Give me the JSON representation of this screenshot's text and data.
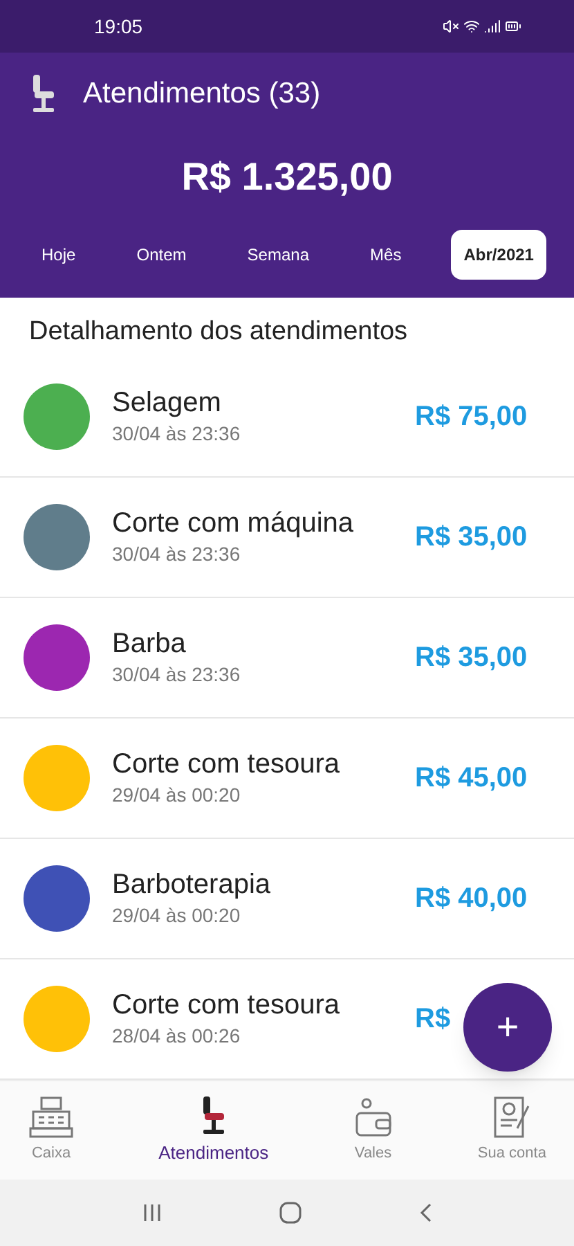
{
  "status_bar": {
    "time": "19:05"
  },
  "header": {
    "title": "Atendimentos (33)",
    "total": "R$ 1.325,00"
  },
  "tabs": [
    {
      "label": "Hoje",
      "selected": false
    },
    {
      "label": "Ontem",
      "selected": false
    },
    {
      "label": "Semana",
      "selected": false
    },
    {
      "label": "Mês",
      "selected": false
    },
    {
      "label": "Abr/2021",
      "selected": true
    }
  ],
  "list": {
    "title": "Detalhamento dos atendimentos",
    "items": [
      {
        "name": "Selagem",
        "date": "30/04 às 23:36",
        "price": "R$ 75,00",
        "color": "#4caf50"
      },
      {
        "name": "Corte com máquina",
        "date": "30/04 às 23:36",
        "price": "R$ 35,00",
        "color": "#607d8b"
      },
      {
        "name": "Barba",
        "date": "30/04 às 23:36",
        "price": "R$ 35,00",
        "color": "#9c27b0"
      },
      {
        "name": "Corte com tesoura",
        "date": "29/04 às 00:20",
        "price": "R$ 45,00",
        "color": "#ffc107"
      },
      {
        "name": "Barboterapia",
        "date": "29/04 às 00:20",
        "price": "R$ 40,00",
        "color": "#3f51b5"
      },
      {
        "name": "Corte com tesoura",
        "date": "28/04 às 00:26",
        "price": "R$",
        "color": "#ffc107"
      }
    ]
  },
  "fab": {
    "label": "+"
  },
  "bottom_nav": [
    {
      "label": "Caixa",
      "kind": "register",
      "selected": false
    },
    {
      "label": "Atendimentos",
      "kind": "chair",
      "selected": true
    },
    {
      "label": "Vales",
      "kind": "wallet",
      "selected": false
    },
    {
      "label": "Sua conta",
      "kind": "account",
      "selected": false
    }
  ]
}
